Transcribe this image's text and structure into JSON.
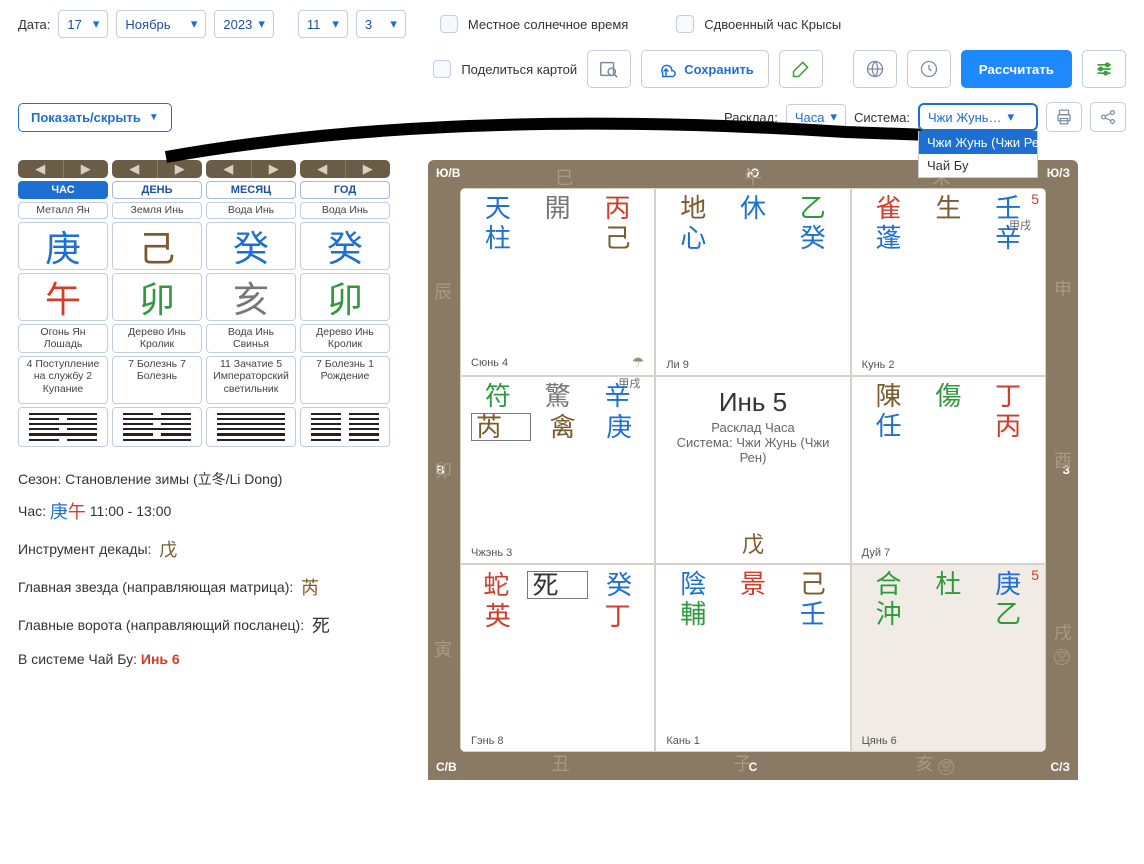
{
  "date": {
    "label": "Дата:",
    "day": "17",
    "month": "Ноябрь",
    "year": "2023",
    "hour": "11",
    "minute": "3",
    "local_time": "Местное солнечное время",
    "rat_hour": "Сдвоенный час Крысы"
  },
  "toolbar": {
    "share_map": "Поделиться картой",
    "save": "Сохранить",
    "calc": "Рассчитать"
  },
  "row3": {
    "show_hide": "Показать/скрыть",
    "rasklad_lbl": "Расклад:",
    "rasklad_val": "Часа",
    "system_lbl": "Система:",
    "system_val": "Чжи Жунь…",
    "opts": [
      "Чжи Жунь (Чжи Рен)",
      "Чай Бу"
    ]
  },
  "pillars": {
    "headers": [
      "ЧАС",
      "ДЕНЬ",
      "МЕСЯЦ",
      "ГОД"
    ],
    "row_stem_lbl": [
      "Металл Ян",
      "Земля Инь",
      "Вода Инь",
      "Вода Инь"
    ],
    "row_stem": [
      "庚",
      "己",
      "癸",
      "癸"
    ],
    "row_branch": [
      "午",
      "卯",
      "亥",
      "卯"
    ],
    "row_branch_lbl": [
      "Огонь Ян Лошадь",
      "Дерево Инь Кролик",
      "Вода Инь Свинья",
      "Дерево Инь Кролик"
    ],
    "row_extra": [
      "4 Поступление на службу\n2 Купание",
      "7 Болезнь\n7 Болезнь",
      "11 Зачатие\n5 Императорский светильник",
      "7 Болезнь\n1 Рождение"
    ],
    "hex": [
      [
        false,
        true,
        false,
        true,
        false,
        true
      ],
      [
        true,
        false,
        true,
        false,
        true,
        false
      ],
      [
        false,
        false,
        false,
        false,
        false,
        false
      ],
      [
        true,
        true,
        true,
        true,
        true,
        true
      ]
    ]
  },
  "info": {
    "season_lbl": "Сезон:",
    "season_val": "Становление зимы (立冬/Li Dong)",
    "hour_lbl": "Час:",
    "hour_stem": "庚",
    "hour_branch": "午",
    "hour_time": "11:00 - 13:00",
    "tool_lbl": "Инструмент декады:",
    "tool_val": "戊",
    "star_lbl": "Главная звезда (направляющая матрица):",
    "star_val": "芮",
    "gate_lbl": "Главные ворота (направляющий посланец):",
    "gate_val": "死",
    "chai_lbl": "В системе Чай Бу:",
    "chai_val": "Инь 6"
  },
  "frame": {
    "corners": {
      "tl": "Ю/В",
      "tr": "Ю/З",
      "bl": "С/В",
      "br": "С/З",
      "l": "В",
      "r": "З",
      "t": "Ю",
      "b": "С"
    },
    "edge_top": [
      "巳",
      "午",
      "未"
    ],
    "edge_bot": [
      "丑",
      "子",
      "亥"
    ],
    "edge_left": [
      "辰",
      "卯",
      "寅"
    ],
    "edge_right": [
      "申",
      "酉",
      "戌"
    ],
    "edge_bot_extra": "空"
  },
  "cells": {
    "c0": {
      "r1": [
        "天",
        "開",
        "丙"
      ],
      "r2": [
        "柱",
        "",
        "己"
      ],
      "foot": "Сюнь 4",
      "icon": "☂"
    },
    "c1": {
      "r1": [
        "地",
        "休",
        "乙"
      ],
      "r2": [
        "心",
        "",
        "癸"
      ],
      "foot": "Ли 9"
    },
    "c2": {
      "badge": "5",
      "r1": [
        "雀",
        "生",
        "壬"
      ],
      "r2": [
        "蓬",
        "",
        "辛"
      ],
      "r2_sup": "甲戌",
      "foot": "Кунь 2"
    },
    "c3": {
      "r1": [
        "符",
        "驚",
        "辛"
      ],
      "r1_sup": "甲戌",
      "r2": [
        "芮",
        "禽",
        "庚"
      ],
      "foot": "Чжэнь 3"
    },
    "c4": {
      "title": "Инь 5",
      "l1": "Расклад Часа",
      "l2": "Система: Чжи Жунь (Чжи Рен)",
      "foot": "戊"
    },
    "c5": {
      "r1": [
        "陳",
        "傷",
        "丁"
      ],
      "r2": [
        "任",
        "",
        "丙"
      ],
      "foot": "Дуй 7"
    },
    "c6": {
      "r1": [
        "蛇",
        "死",
        "癸"
      ],
      "r2": [
        "英",
        "",
        "丁"
      ],
      "foot": "Гэнь 8"
    },
    "c7": {
      "r1": [
        "陰",
        "景",
        "己"
      ],
      "r2": [
        "輔",
        "",
        "壬"
      ],
      "foot": "Кань 1"
    },
    "c8": {
      "badge": "5",
      "r1": [
        "合",
        "杜",
        "庚"
      ],
      "r2": [
        "沖",
        "",
        "乙"
      ],
      "foot": "Цянь 6"
    }
  }
}
